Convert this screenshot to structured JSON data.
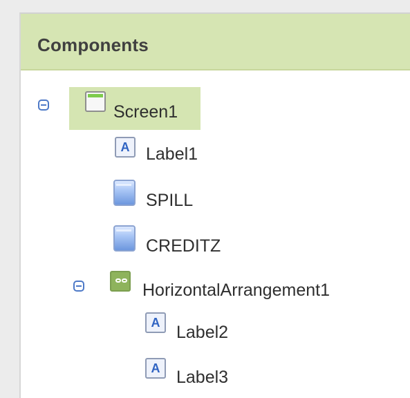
{
  "panel": {
    "title": "Components"
  },
  "tree": {
    "screen": {
      "label": "Screen1",
      "icon": "screen-icon",
      "collapse_icon": "collapse-icon"
    },
    "items": [
      {
        "label": "Label1",
        "icon": "label-icon"
      },
      {
        "label": "SPILL",
        "icon": "button-icon"
      },
      {
        "label": "CREDITZ",
        "icon": "button-icon"
      }
    ],
    "horizontal_arrangement": {
      "label": "HorizontalArrangement1",
      "icon": "horizontal-arrangement-icon",
      "collapse_icon": "collapse-icon",
      "children": [
        {
          "label": "Label2",
          "icon": "label-icon"
        },
        {
          "label": "Label3",
          "icon": "label-icon"
        }
      ]
    }
  },
  "icon_glyphs": {
    "label": "A"
  },
  "colors": {
    "header_bg": "#d6e5b3",
    "selected_bg": "#d5e5b2",
    "collapse_blue": "#4d79c7"
  }
}
